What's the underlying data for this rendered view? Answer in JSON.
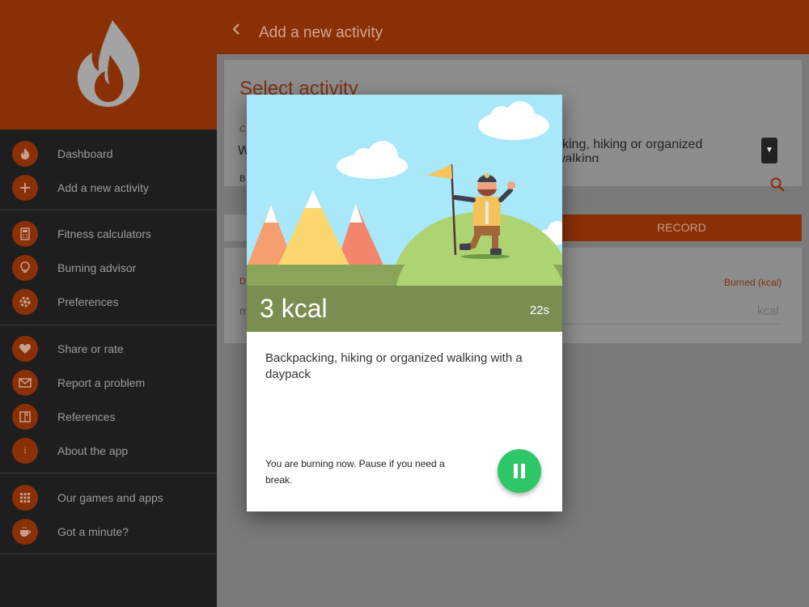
{
  "topbar": {
    "title": "Add a new activity"
  },
  "sidebar": {
    "items": [
      {
        "label": "Dashboard",
        "icon": "flame-icon"
      },
      {
        "label": "Add a new activity",
        "icon": "plus-icon"
      },
      {
        "label": "Fitness calculators",
        "icon": "calculator-icon"
      },
      {
        "label": "Burning advisor",
        "icon": "lightbulb-icon"
      },
      {
        "label": "Preferences",
        "icon": "gear-icon"
      },
      {
        "label": "Share or rate",
        "icon": "heart-icon"
      },
      {
        "label": "Report a problem",
        "icon": "envelope-icon"
      },
      {
        "label": "References",
        "icon": "book-icon"
      },
      {
        "label": "About the app",
        "icon": "info-icon"
      },
      {
        "label": "Our games and apps",
        "icon": "grid-icon"
      },
      {
        "label": "Got a minute?",
        "icon": "coffee-icon"
      }
    ]
  },
  "main": {
    "select_title": "Select activity",
    "dropdown_text": "cking, hiking or organized walking\ndaypack",
    "record_label": "RECORD",
    "burned_header": "Burned (kcal)",
    "kcal_unit": "kcal",
    "small_c": "C",
    "small_w": "W",
    "small_b": "B",
    "small_d": "D",
    "small_m": "m"
  },
  "dialog": {
    "kcal": "3 kcal",
    "time": "22s",
    "activity": "Backpacking, hiking or organized walking with a daypack",
    "status": "You are burning now. Pause if you need a break."
  },
  "colors": {
    "accent": "#8a3006",
    "sidebar_bg": "#1e1e1e",
    "pause_green": "#2ec768",
    "kcal_band": "#7a8e52"
  }
}
